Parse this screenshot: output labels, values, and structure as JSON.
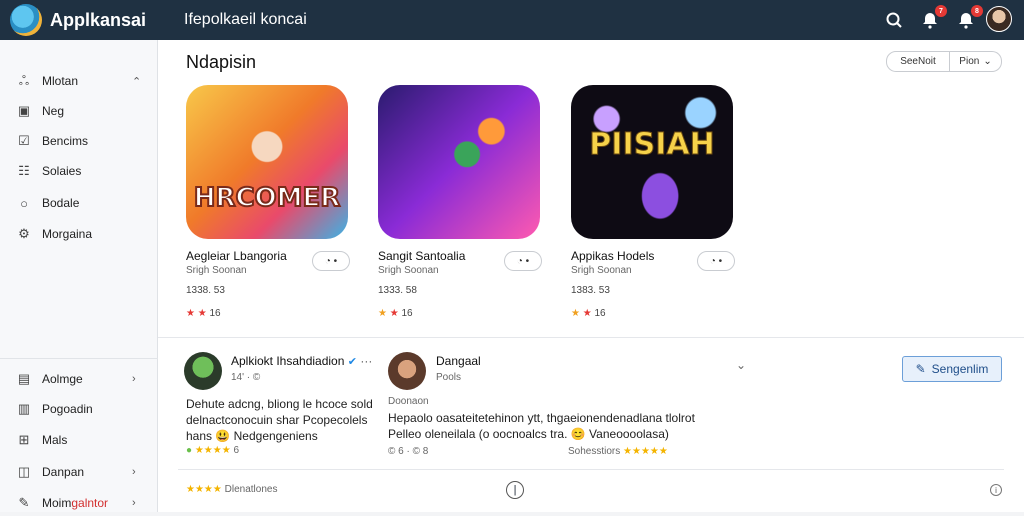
{
  "app": {
    "title": "Applkansai",
    "search_text": "Ifepolkaeil koncai"
  },
  "topbar": {
    "notif_badge_1": "7",
    "notif_badge_2": "8"
  },
  "sidebar": {
    "items": [
      {
        "icon": "rocket-icon",
        "label": "Mlotan",
        "chevron": "up"
      },
      {
        "icon": "image-icon",
        "label": "Neg"
      },
      {
        "icon": "checkbox-icon",
        "label": "Bencims"
      },
      {
        "icon": "checklist-icon",
        "label": "Solaies"
      },
      {
        "icon": "circle-icon",
        "label": "Bodale"
      },
      {
        "icon": "settings-icon",
        "label": "Morgaina"
      }
    ],
    "bottom_items": [
      {
        "icon": "chart-icon",
        "label": "Aolmge",
        "chevron": "down"
      },
      {
        "icon": "book-icon",
        "label": "Pogoadin"
      },
      {
        "icon": "grid-icon",
        "label": "Mals"
      },
      {
        "icon": "chat-icon",
        "label": "Danpan",
        "chevron": "down"
      },
      {
        "icon": "pencil-icon",
        "label": "Moimgalntor",
        "label_accent": "#d32f2f",
        "chevron": "down"
      }
    ]
  },
  "main": {
    "section_title": "Ndapisin",
    "sort_label": "SeeNoit",
    "filter_label": "Pion",
    "apps": [
      {
        "name": "Aegleiar Lbangoria",
        "sub": "Srigh Soonan",
        "meta": "1338. 53",
        "stars": "★ ★  16",
        "art_text": "HRCOMER"
      },
      {
        "name": "Sangit Santoalia",
        "sub": "Srigh Soonan",
        "meta": "1333. 58",
        "stars": "★ ★  16",
        "art_text": ""
      },
      {
        "name": "Appikas Hodels",
        "sub": "Srigh Soonan",
        "meta": "1383. 53",
        "stars": "★ ★  16",
        "art_text": "PIISIAH"
      }
    ],
    "get_label": "◔ •",
    "reviews": [
      {
        "author": "Aplkiokt Ihsahdiadion",
        "meta": "14' ·  ©",
        "body": "Dehute adcng, bliong le hcoce sold delnactconocuin shar Pcopecolels hans 😃 Nedgengeniens",
        "rating_label": "★★★★  6"
      },
      {
        "author": "Dangaal",
        "meta": "Pools",
        "handle": "Doonaon",
        "body": "Hepaolo oasateitetehinon ytt, thgaeionendenadlana tlolrot Pelleo oleneilala (o oocnoalcs tra. 😊 Vaneoooolasa)",
        "rating_label": "© 6  ·  ©  8",
        "right_rating": "Sohesstiors   ★★★★★"
      }
    ],
    "follow_label": "Sengenlim",
    "footer_rating": "Dlenatlones"
  }
}
